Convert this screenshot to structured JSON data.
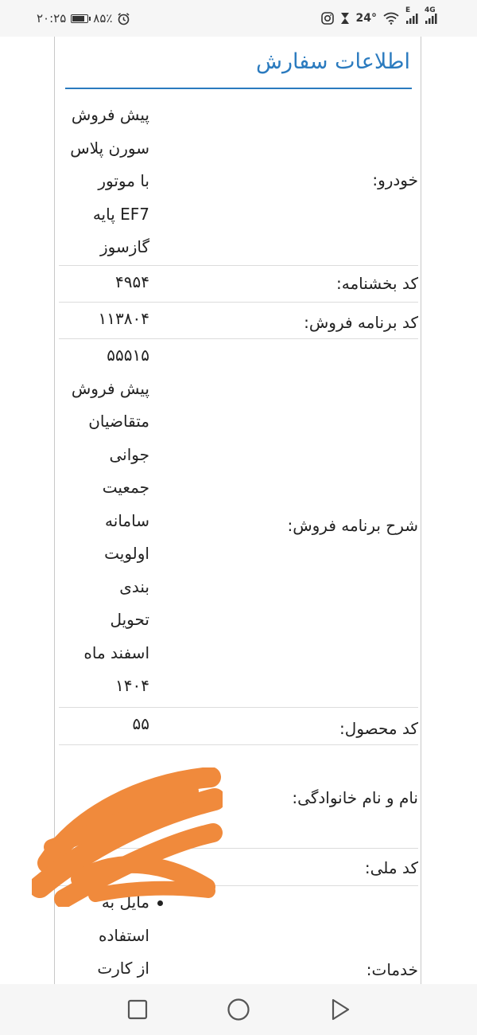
{
  "status_bar": {
    "time": "۲۰:۲۵",
    "battery_percent": "۸۵٪",
    "temperature": "24°",
    "network_left": "E",
    "network_right": "4G",
    "icons": [
      "instagram-icon",
      "hourglass-icon",
      "wifi-icon",
      "signal-icon",
      "alarm-icon",
      "battery-icon"
    ]
  },
  "panel": {
    "title": "اطلاعات سفارش"
  },
  "rows": [
    {
      "label": "خودرو:",
      "value_lines": [
        "پیش فروش",
        "سورن پلاس",
        "با موتور",
        "EF7 پایه",
        "گازسوز"
      ]
    },
    {
      "label": "کد بخشنامه:",
      "value_lines": [
        "۴۹۵۴"
      ]
    },
    {
      "label": "کد برنامه فروش:",
      "value_lines": [
        "۱۱۳۸۰۴"
      ]
    },
    {
      "label": "شرح برنامه فروش:",
      "value_lines": [
        "۵۵۵۱۵",
        "پیش فروش",
        "متقاضیان",
        "جوانی",
        "جمعیت",
        "سامانه",
        "اولویت",
        "بندی",
        "تحویل",
        "اسفند ماه",
        "۱۴۰۴"
      ]
    },
    {
      "label": "کد محصول:",
      "value_lines": [
        "۵۵"
      ]
    },
    {
      "label": "نام و نام خانوادگی:",
      "value_lines": []
    },
    {
      "label": "کد ملی:",
      "value_lines": []
    },
    {
      "label": "خدمات:",
      "value_lines": [
        "مایل به",
        "استفاده",
        "از کارت"
      ]
    }
  ],
  "colors": {
    "accent": "#2b7bbf",
    "redaction": "#f08a3c",
    "divider": "#dcdcdc"
  },
  "nav_bar": {
    "icons": [
      "recents-square-icon",
      "home-circle-icon",
      "back-triangle-icon"
    ]
  }
}
